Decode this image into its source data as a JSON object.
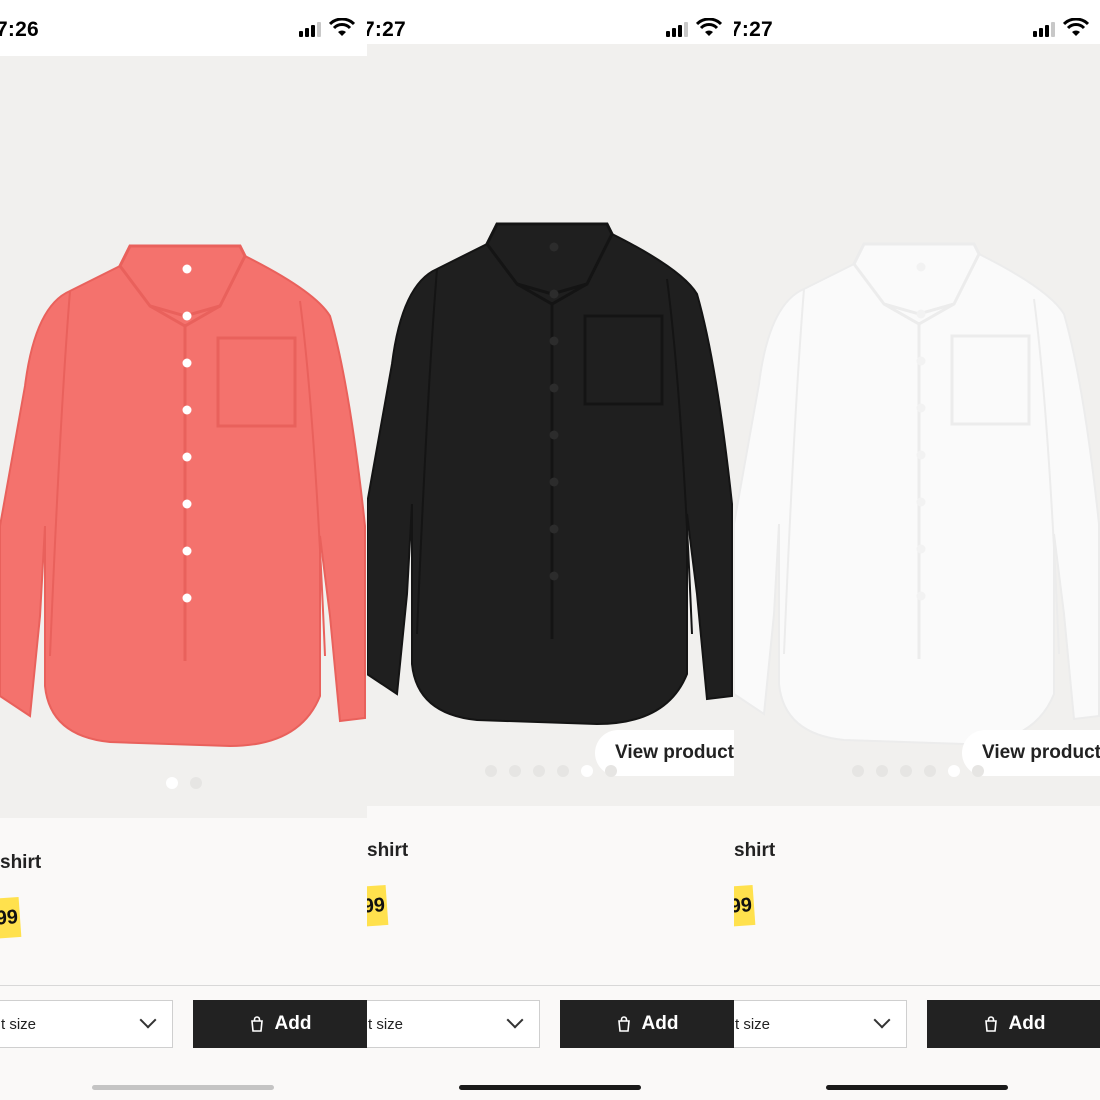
{
  "panels": [
    {
      "time": "7:26",
      "shirt_color": "#f4726d",
      "shirt_shade": "#e9615c",
      "button_color": "#ffffff",
      "title": "shirt",
      "price": "99",
      "dots_count": 2,
      "active_dot": 1,
      "view_product": "",
      "size_label": "t size",
      "add_label": "Add"
    },
    {
      "time": "7:27",
      "shirt_color": "#1f1f1f",
      "shirt_shade": "#141414",
      "button_color": "#2c2c2c",
      "title": "shirt",
      "price": "99",
      "dots_count": 6,
      "active_dot": 5,
      "view_product": "View product",
      "size_label": "t size",
      "add_label": "Add"
    },
    {
      "time": "7:27",
      "shirt_color": "#fafafa",
      "shirt_shade": "#ececec",
      "button_color": "#f2f2f2",
      "title": "shirt",
      "price": "99",
      "dots_count": 6,
      "active_dot": 5,
      "view_product": "View product",
      "size_label": "t size",
      "add_label": "Add"
    }
  ]
}
